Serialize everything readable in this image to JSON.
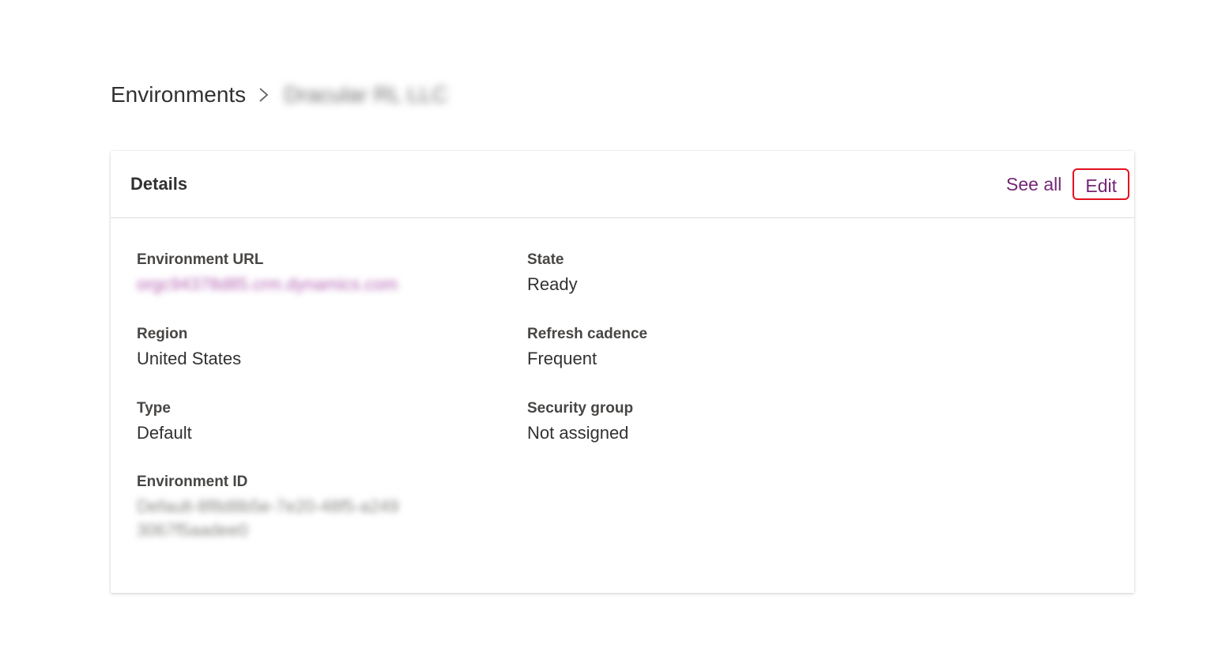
{
  "breadcrumb": {
    "root": "Environments",
    "current": "Dracular RL LLC"
  },
  "details": {
    "title": "Details",
    "see_all_label": "See all",
    "edit_label": "Edit",
    "fields": {
      "environment_url": {
        "label": "Environment URL",
        "value": "orgc94378d85.crm.dynamics.com"
      },
      "state": {
        "label": "State",
        "value": "Ready"
      },
      "region": {
        "label": "Region",
        "value": "United States"
      },
      "refresh_cadence": {
        "label": "Refresh cadence",
        "value": "Frequent"
      },
      "type": {
        "label": "Type",
        "value": "Default"
      },
      "security_group": {
        "label": "Security group",
        "value": "Not assigned"
      },
      "environment_id": {
        "label": "Environment ID",
        "value_line1": "Default-8f8d8b5e-7e20-48f5-a249",
        "value_line2": "3067f5aadee0"
      }
    }
  },
  "colors": {
    "accent": "#742774",
    "highlight": "#e3101e",
    "text": "#323130"
  }
}
